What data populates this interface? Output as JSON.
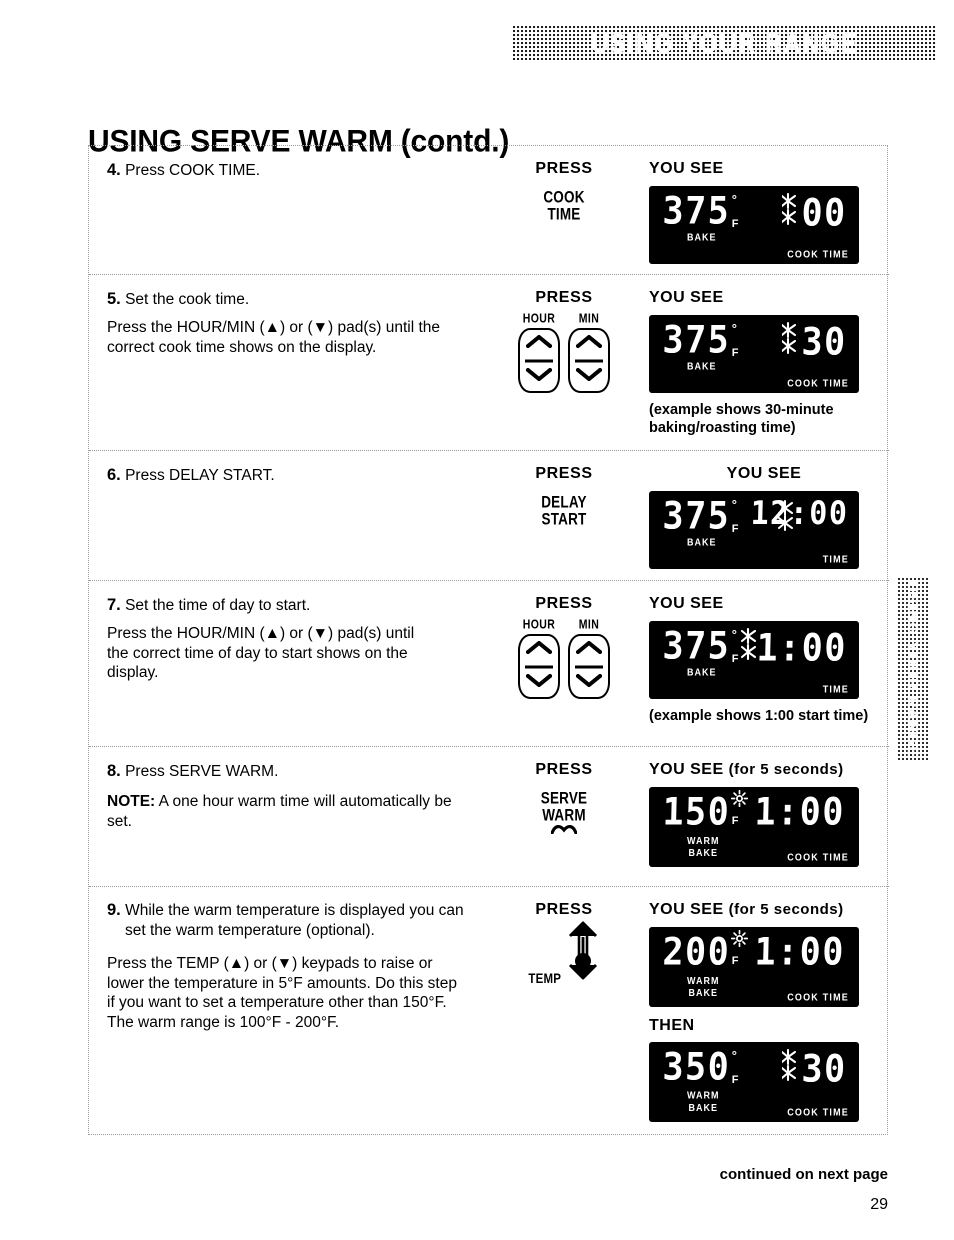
{
  "header": {
    "banner_text": "USING YOUR RANGE",
    "side_tab_text": "USING YOUR RANGE"
  },
  "page_title": "USING SERVE WARM (contd.)",
  "columns": {
    "press": "PRESS",
    "you_see": "YOU SEE",
    "you_see_5s_suffix": "(for 5 seconds)",
    "then": "THEN"
  },
  "steps": [
    {
      "number": "4.",
      "heading": "Press COOK TIME.",
      "body": "",
      "press_key": "COOK\nTIME",
      "display": {
        "temp": "375",
        "degree": "°",
        "unit": "F",
        "mode_label": "BAKE",
        "time": "00",
        "time_label": "COOK TIME"
      }
    },
    {
      "number": "5.",
      "heading": "Set the cook time.",
      "body": "Press the HOUR/MIN (▲) or (▼) pad(s) until the correct cook time shows on the display.",
      "pads": [
        "HOUR",
        "MIN"
      ],
      "display": {
        "temp": "375",
        "degree": "°",
        "unit": "F",
        "mode_label": "BAKE",
        "time": "30",
        "time_label": "COOK TIME"
      },
      "caption": "(example shows 30-minute baking/roasting time)"
    },
    {
      "number": "6.",
      "heading": "Press DELAY START.",
      "body": "",
      "press_key": "DELAY\nSTART",
      "display": {
        "temp": "375",
        "degree": "°",
        "unit": "F",
        "mode_label": "BAKE",
        "time": "12:00",
        "time_label": "TIME"
      }
    },
    {
      "number": "7.",
      "heading": "Set the time of day to start.",
      "body": "Press the HOUR/MIN (▲) or (▼) pad(s) until the correct time of day to start shows on the display.",
      "pads": [
        "HOUR",
        "MIN"
      ],
      "display": {
        "temp": "375",
        "degree": "°",
        "unit": "F",
        "mode_label": "BAKE",
        "time": "1:00",
        "time_label": "TIME"
      },
      "caption": "(example shows 1:00 start time)"
    },
    {
      "number": "8.",
      "heading": "Press SERVE WARM.",
      "note_label": "NOTE:",
      "note_text": " A one hour warm time will automatically be set.",
      "press_key": "SERVE\nWARM",
      "display": {
        "temp": "150",
        "unit": "F",
        "mode_label_line1": "WARM",
        "mode_label_line2": "BAKE",
        "time": "1:00",
        "time_label": "COOK TIME"
      }
    },
    {
      "number": "9.",
      "heading": "While the warm temperature is displayed you can set the warm temperature (optional).",
      "body": "Press the TEMP (▲) or (▼) keypads to raise or lower the temperature in 5°F amounts. Do this step if you want to set a temperature other than 150°F. The warm range is 100°F - 200°F.",
      "press_key": "TEMP",
      "display": {
        "temp": "200",
        "unit": "F",
        "mode_label_line1": "WARM",
        "mode_label_line2": "BAKE",
        "time": "1:00",
        "time_label": "COOK TIME"
      },
      "display_then": {
        "temp": "350",
        "degree": "°",
        "unit": "F",
        "mode_label_line1": "WARM",
        "mode_label_line2": "BAKE",
        "time": "30",
        "time_label": "COOK TIME"
      }
    }
  ],
  "footer": {
    "continued": "continued on next page",
    "page_number": "29"
  }
}
